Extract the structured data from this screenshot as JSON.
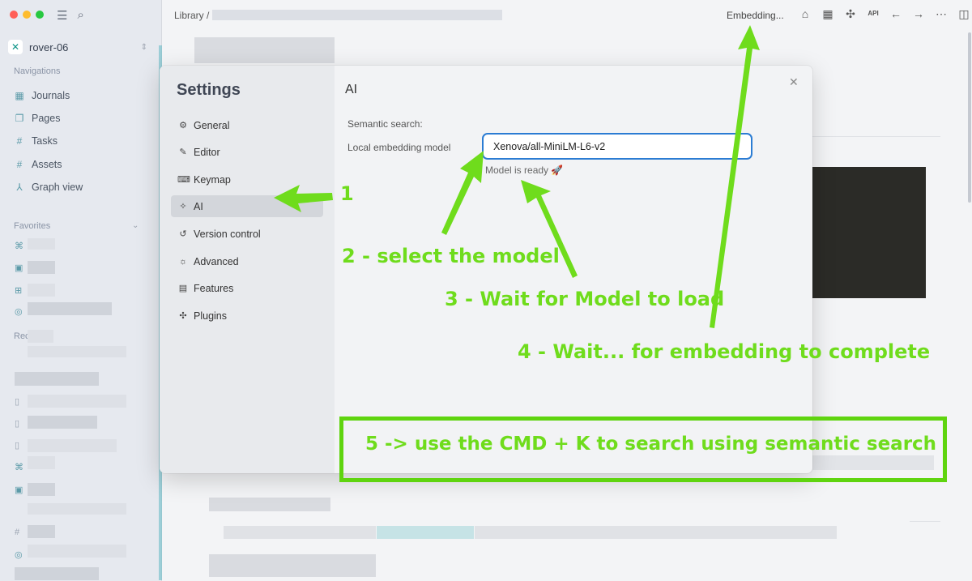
{
  "sidebar": {
    "graph_name": "rover-06",
    "nav_heading": "Navigations",
    "nav_items": [
      {
        "label": "Journals",
        "icon": "calendar-icon"
      },
      {
        "label": "Pages",
        "icon": "pages-icon"
      },
      {
        "label": "Tasks",
        "icon": "hash-icon"
      },
      {
        "label": "Assets",
        "icon": "hash-icon"
      },
      {
        "label": "Graph view",
        "icon": "graph-icon"
      }
    ],
    "favorites_heading": "Favorites",
    "recent_heading": "Rec"
  },
  "topbar": {
    "breadcrumb": "Library /",
    "status": "Embedding...",
    "api_label": "API"
  },
  "settings": {
    "title": "Settings",
    "menu": [
      {
        "label": "General",
        "icon": "sliders-icon"
      },
      {
        "label": "Editor",
        "icon": "editor-icon"
      },
      {
        "label": "Keymap",
        "icon": "keyboard-icon"
      },
      {
        "label": "AI",
        "icon": "magic-wand-icon"
      },
      {
        "label": "Version control",
        "icon": "history-icon"
      },
      {
        "label": "Advanced",
        "icon": "bulb-icon"
      },
      {
        "label": "Features",
        "icon": "features-icon"
      },
      {
        "label": "Plugins",
        "icon": "puzzle-icon"
      }
    ],
    "active_item": "AI",
    "section_heading": "AI",
    "semantic_search_label": "Semantic search:",
    "local_model_label": "Local embedding model",
    "model_value": "Xenova/all-MiniLM-L6-v2",
    "model_status": "Model is ready 🚀"
  },
  "annotations": {
    "step1": "1",
    "step2": "2 - select the model",
    "step3": "3 - Wait for Model to load",
    "step4": "4 - Wait... for embedding to complete",
    "step5": "5 -> use the CMD + K to search using semantic search",
    "color": "#6fdc1c"
  }
}
